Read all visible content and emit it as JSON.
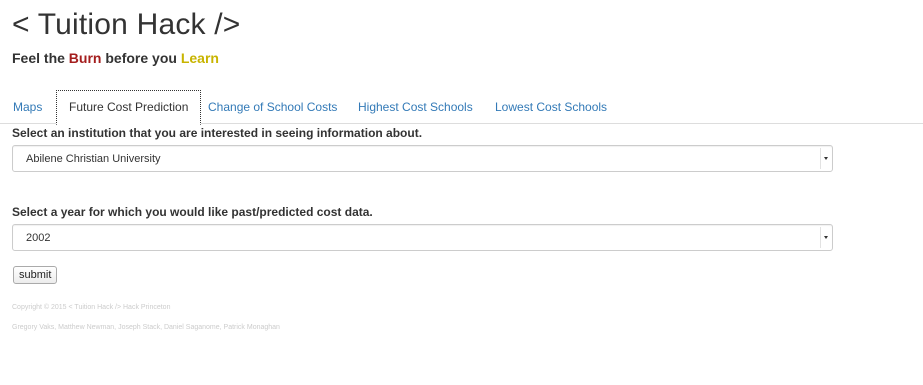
{
  "header": {
    "title": "< Tuition Hack />",
    "tagline": {
      "part1": "Feel the ",
      "burn": "Burn",
      "part2": " before you ",
      "learn": "Learn"
    }
  },
  "tabs": [
    {
      "label": "Maps",
      "active": false
    },
    {
      "label": "Future Cost Prediction",
      "active": true
    },
    {
      "label": "Change of School Costs",
      "active": false
    },
    {
      "label": "Highest Cost Schools",
      "active": false
    },
    {
      "label": "Lowest Cost Schools",
      "active": false
    }
  ],
  "form": {
    "institution_label": "Select an institution that you are interested in seeing information about.",
    "institution_value": "Abilene Christian University",
    "year_label": "Select a year for which you would like past/predicted cost data.",
    "year_value": "2002",
    "submit_label": "submit"
  },
  "footer": {
    "copyright": "Copyright © 2015 < Tuition Hack /> Hack Princeton",
    "authors": "Gregory Vaks, Matthew Newman, Joseph Stack, Daniel Saganome, Patrick Monaghan"
  },
  "colors": {
    "burn": "#a41d1d",
    "learn": "#c8b400",
    "link": "#337ab7"
  }
}
